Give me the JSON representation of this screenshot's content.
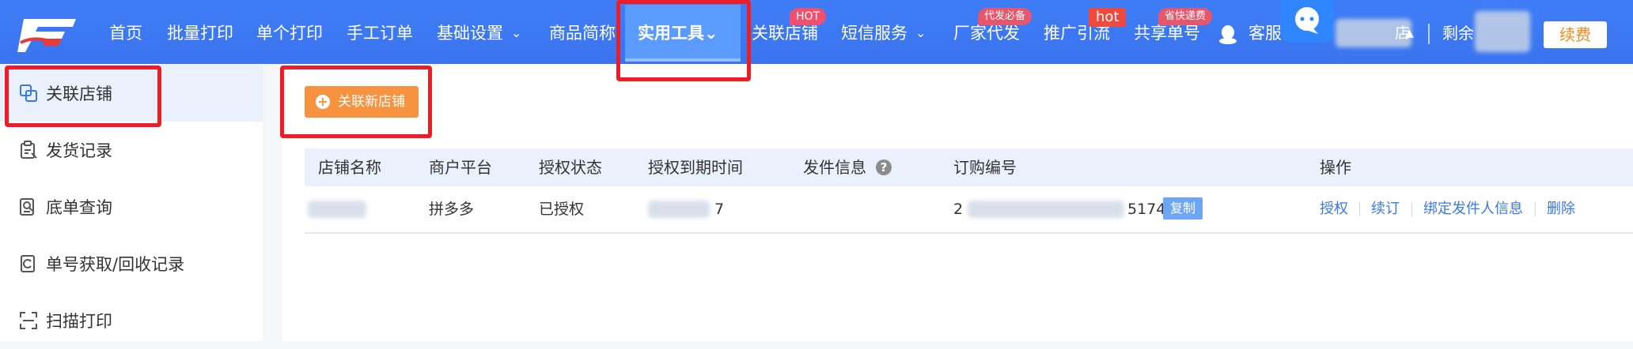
{
  "nav": {
    "items": [
      {
        "label": "首页"
      },
      {
        "label": "批量打印"
      },
      {
        "label": "单个打印"
      },
      {
        "label": "手工订单"
      },
      {
        "label": "基础设置"
      },
      {
        "label": "商品简称"
      },
      {
        "label": "实用工具"
      },
      {
        "label": "关联店铺"
      },
      {
        "label": "短信服务"
      },
      {
        "label": "厂家代发"
      },
      {
        "label": "推广引流"
      },
      {
        "label": "共享单号"
      },
      {
        "label": "客服"
      }
    ],
    "badges": {
      "hot_upper": "HOT",
      "daifa": "代发必备",
      "hot_lower": "hot",
      "saving": "省快递费"
    },
    "right": {
      "shop_suffix": "店",
      "remaining": "剩余",
      "renew": "续费"
    }
  },
  "sidebar": {
    "items": [
      {
        "label": "关联店铺",
        "icon": "link-shop-icon"
      },
      {
        "label": "发货记录",
        "icon": "clipboard-icon"
      },
      {
        "label": "底单查询",
        "icon": "search-doc-icon"
      },
      {
        "label": "单号获取/回收记录",
        "icon": "recycle-icon"
      },
      {
        "label": "扫描打印",
        "icon": "scan-icon"
      }
    ]
  },
  "main": {
    "add_button": "关联新店铺",
    "columns": [
      "店铺名称",
      "商户平台",
      "授权状态",
      "授权到期时间",
      "发件信息",
      "订购编号",
      "操作"
    ],
    "row": {
      "platform": "拼多多",
      "status": "已授权",
      "expire_tail": "7",
      "order_head": "2",
      "order_tail": "5174",
      "copy": "复制"
    },
    "actions": [
      "授权",
      "续订",
      "绑定发件人信息",
      "删除"
    ]
  },
  "colors": {
    "nav_bg": "#3a74ee",
    "accent_orange": "#f7933f",
    "link_blue": "#3a78e6",
    "highlight_red": "#ee1c25"
  }
}
